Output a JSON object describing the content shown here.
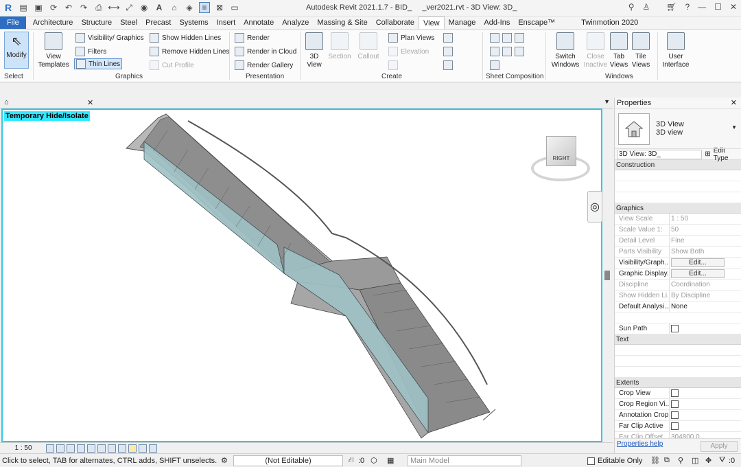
{
  "window": {
    "title": "Autodesk Revit 2021.1.7 - BID_     _ver2021.rvt - 3D View: 3D_",
    "user": "",
    "qat_icons": [
      "revit-logo-icon",
      "open-icon",
      "save-icon",
      "sync-icon",
      "undo-icon",
      "redo-icon",
      "print-icon",
      "measure-icon",
      "dimension-icon",
      "tag-icon",
      "text-icon",
      "3d-icon",
      "section-icon",
      "thin-lines-icon",
      "close-hidden-icon",
      "switch-windows-icon"
    ]
  },
  "tabs": [
    "File",
    "Architecture",
    "Structure",
    "Steel",
    "Precast",
    "Systems",
    "Insert",
    "Annotate",
    "Analyze",
    "Massing & Site",
    "Collaborate",
    "View",
    "Manage",
    "Add-Ins",
    "Enscape™",
    "Twinmotion 2020"
  ],
  "active_tab": "View",
  "ribbon": {
    "select": {
      "modify": "Modify",
      "panel": "Select"
    },
    "graphics": {
      "view_templates": "View Templates",
      "visibility": "Visibility/ Graphics",
      "filters": "Filters",
      "thin_lines": "Thin  Lines",
      "show_hidden": "Show  Hidden Lines",
      "remove_hidden": "Remove  Hidden Lines",
      "cut_profile": "Cut  Profile",
      "panel": "Graphics"
    },
    "presentation": {
      "render": "Render",
      "render_cloud": "Render  in Cloud",
      "render_gallery": "Render  Gallery",
      "panel": "Presentation"
    },
    "create": {
      "view3d": "3D View",
      "section": "Section",
      "callout": "Callout",
      "plan_views": "Plan  Views",
      "elevation": "Elevation",
      "panel": "Create"
    },
    "sheet": {
      "panel": "Sheet Composition"
    },
    "windows": {
      "switch": "Switch Windows",
      "close_inactive": "Close Inactive",
      "tab_views": "Tab Views",
      "tile_views": "Tile Views",
      "user_interface": "User Interface",
      "panel": "Windows"
    }
  },
  "view": {
    "hide_isolate": "Temporary Hide/Isolate",
    "scale": "1 : 50",
    "viewcube_face": "RIGHT"
  },
  "status": {
    "text": "Click to select, TAB for alternates, CTRL adds, SHIFT unselects.",
    "workset": "(Not Editable)",
    "zero1": ":0",
    "design_option": "Main Model",
    "editable_only": "Editable Only",
    "zero2": ":0"
  },
  "properties": {
    "title": "Properties",
    "type_line1": "3D View",
    "type_line2": "3D view",
    "instance": "3D View: 3D_",
    "edit_type": "Edit Type",
    "groups": {
      "construction": "Construction",
      "graphics": "Graphics",
      "text": "Text",
      "extents": "Extents"
    },
    "graphics_rows": [
      {
        "k": "View Scale",
        "v": "1 : 50",
        "dim": true
      },
      {
        "k": "Scale Value    1:",
        "v": "50",
        "dim": true
      },
      {
        "k": "Detail Level",
        "v": "Fine",
        "dim": true
      },
      {
        "k": "Parts Visibility",
        "v": "Show Both",
        "dim": true
      },
      {
        "k": "Visibility/Graph...",
        "v": "Edit...",
        "btn": true
      },
      {
        "k": "Graphic Display...",
        "v": "Edit...",
        "btn": true
      },
      {
        "k": "Discipline",
        "v": "Coordination",
        "dim": true
      },
      {
        "k": "Show Hidden Li...",
        "v": "By Discipline",
        "dim": true
      },
      {
        "k": "Default Analysi...",
        "v": "None"
      }
    ],
    "sun_path": "Sun Path",
    "extents_rows": [
      "Crop View",
      "Crop Region Vi...",
      "Annotation Crop",
      "Far Clip Active"
    ],
    "far_clip_offset": {
      "k": "Far Clip Offset",
      "v": "304800.0"
    },
    "help": "Properties help",
    "apply": "Apply"
  }
}
